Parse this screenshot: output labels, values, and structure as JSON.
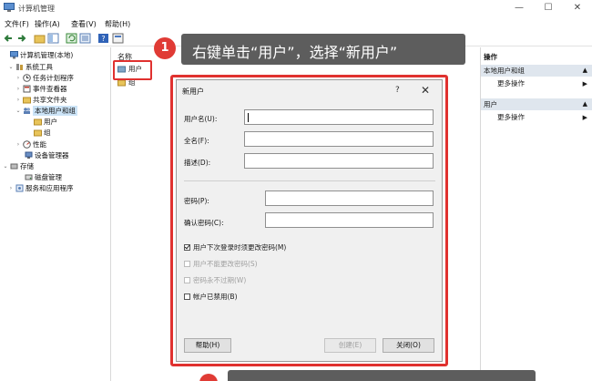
{
  "window": {
    "title": "计算机管理"
  },
  "menu": {
    "file": "文件(F)",
    "action": "操作(A)",
    "view": "查看(V)",
    "help": "帮助(H)"
  },
  "tree": {
    "root": "计算机管理(本地)",
    "system_tools": "系统工具",
    "task_scheduler": "任务计划程序",
    "event_viewer": "事件查看器",
    "shared_folders": "共享文件夹",
    "local_users_groups": "本地用户和组",
    "users": "用户",
    "groups": "组",
    "performance": "性能",
    "device_manager": "设备管理器",
    "storage": "存储",
    "disk_management": "磁盘管理",
    "services_apps": "服务和应用程序"
  },
  "middle": {
    "column_name": "名称",
    "items": [
      "用户",
      "组"
    ]
  },
  "callout": {
    "step": "1",
    "text": "右键单击“用户”，选择“新用户”"
  },
  "dialog": {
    "title": "新用户",
    "help_glyph": "?",
    "close_glyph": "✕",
    "username_label": "用户名(U):",
    "fullname_label": "全名(F):",
    "description_label": "描述(D):",
    "password_label": "密码(P):",
    "confirm_label": "确认密码(C):",
    "chk_must_change": "用户下次登录时须更改密码(M)",
    "chk_cannot_change": "用户不能更改密码(S)",
    "chk_never_expires": "密码永不过期(W)",
    "chk_disabled": "帐户已禁用(B)",
    "help_button": "帮助(H)",
    "create_button": "创建(E)",
    "close_button": "关闭(O)"
  },
  "actions": {
    "header": "操作",
    "section1": "本地用户和组",
    "more1": "更多操作",
    "section2": "用户",
    "more2": "更多操作"
  },
  "colors": {
    "accent_red": "#e0312f",
    "callout_bg": "#5d5d5d",
    "selection": "#cce4f7"
  }
}
